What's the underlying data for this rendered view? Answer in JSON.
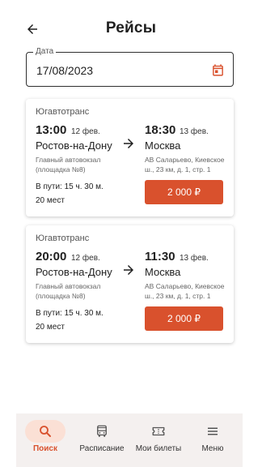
{
  "header": {
    "title": "Рейсы",
    "back_icon": "arrow-left-icon"
  },
  "date_field": {
    "label": "Дата",
    "value": "17/08/2023",
    "icon": "calendar-icon"
  },
  "colors": {
    "accent": "#d9512d",
    "accent_light": "#fbe0d5",
    "nav_background": "#f4f0ef"
  },
  "trips": [
    {
      "carrier": "Югавтотранс",
      "departure": {
        "time": "13:00",
        "date": "12 фев.",
        "city": "Ростов-на-Дону",
        "station": "Главный автовокзал (площадка №8)"
      },
      "arrival": {
        "time": "18:30",
        "date": "13 фев.",
        "city": "Москва",
        "station": "АВ Саларьево, Киевское ш., 23 км, д. 1, стр. 1"
      },
      "duration": "В пути: 15 ч.  30 м.",
      "seats": "20 мест",
      "price": "2 000 ₽"
    },
    {
      "carrier": "Югавтотранс",
      "departure": {
        "time": "20:00",
        "date": "12 фев.",
        "city": "Ростов-на-Дону",
        "station": "Главный автовокзал (площадка №8)"
      },
      "arrival": {
        "time": "11:30",
        "date": "13 фев.",
        "city": "Москва",
        "station": "АВ Саларьево, Киевское ш., 23 км, д. 1, стр. 1"
      },
      "duration": "В пути: 15 ч.  30 м.",
      "seats": "20 мест",
      "price": "2 000 ₽"
    }
  ],
  "bottom_nav": {
    "items": [
      {
        "label": "Поиск",
        "icon": "search-icon",
        "active": true
      },
      {
        "label": "Расписание",
        "icon": "bus-icon",
        "active": false
      },
      {
        "label": "Мои билеты",
        "icon": "ticket-icon",
        "active": false
      },
      {
        "label": "Меню",
        "icon": "menu-icon",
        "active": false
      }
    ]
  }
}
